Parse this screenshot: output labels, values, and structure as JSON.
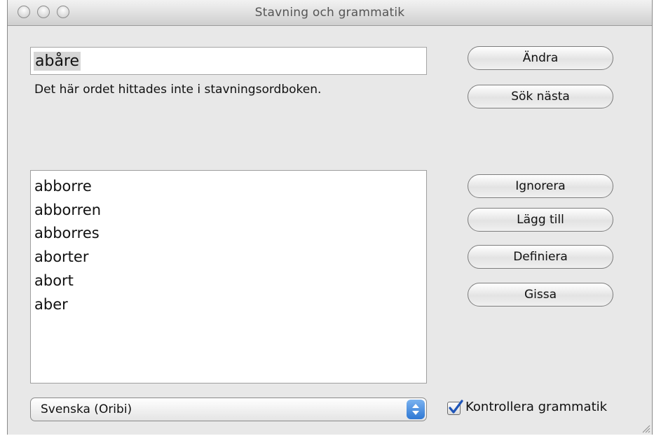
{
  "window": {
    "title": "Stavning och grammatik"
  },
  "word_field": {
    "value": "abåre"
  },
  "status": {
    "text": "Det här ordet hittades inte i stavningsordboken."
  },
  "buttons": {
    "change": "Ändra",
    "find_next": "Sök nästa",
    "ignore": "Ignorera",
    "learn": "Lägg till",
    "define": "Definiera",
    "guess": "Gissa"
  },
  "suggestions": [
    "abborre",
    "abborren",
    "abborres",
    "aborter",
    "abort",
    "aber"
  ],
  "language": {
    "selected": "Svenska (Oribi)"
  },
  "grammar_check": {
    "label": "Kontrollera grammatik",
    "checked": true
  },
  "colors": {
    "window_bg": "#e8e8e8",
    "select_accent": "#2f78d4",
    "checkmark": "#1f55b8"
  },
  "icons": [
    "close-icon",
    "minimize-icon",
    "zoom-icon",
    "select-arrows-icon",
    "checkmark-icon",
    "resize-grip-icon"
  ]
}
